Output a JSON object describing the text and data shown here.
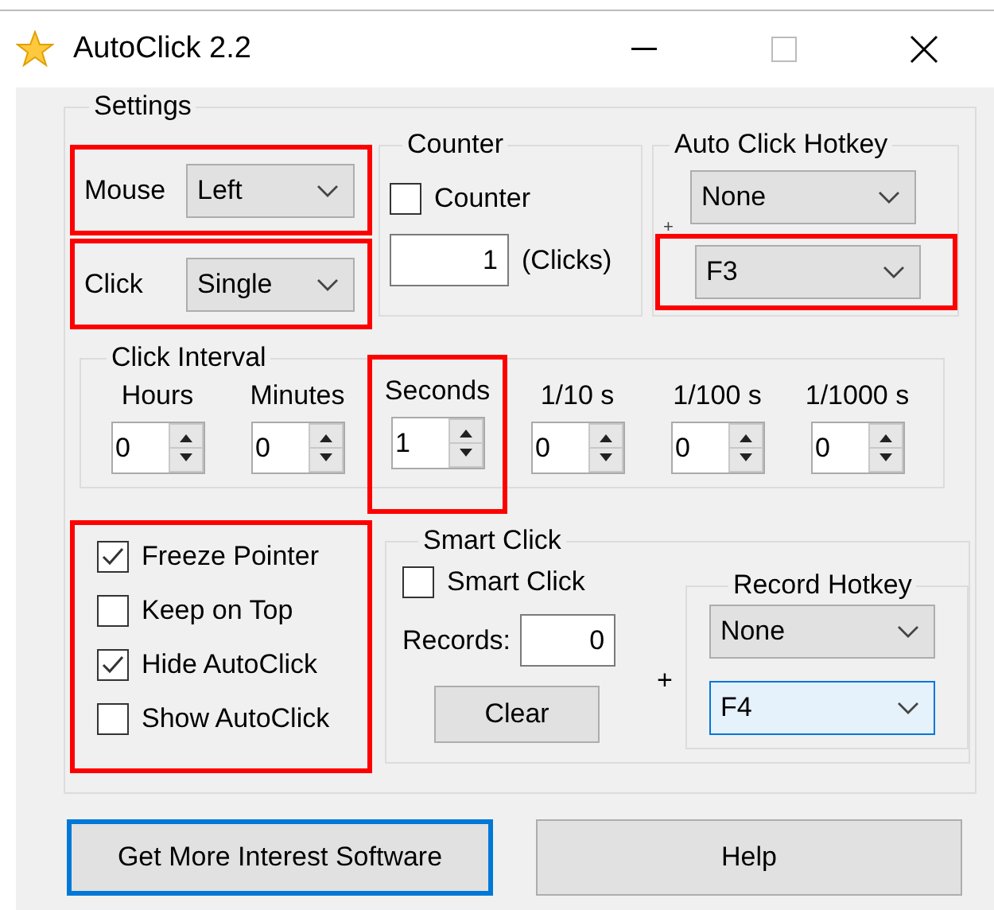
{
  "window": {
    "title": "AutoClick 2.2"
  },
  "settings": {
    "label": "Settings",
    "mouse": {
      "label": "Mouse",
      "value": "Left",
      "highlighted": true
    },
    "click": {
      "label": "Click",
      "value": "Single",
      "highlighted": true
    },
    "counter": {
      "label": "Counter",
      "checkbox_label": "Counter",
      "checked": false,
      "value": "1",
      "unit": "(Clicks)"
    },
    "auto_click_hotkey": {
      "label": "Auto Click Hotkey",
      "modifier": "None",
      "plus": "+",
      "key": "F3",
      "key_highlighted": true
    },
    "click_interval": {
      "label": "Click Interval",
      "fields": [
        {
          "label": "Hours",
          "value": "0",
          "highlighted": false
        },
        {
          "label": "Minutes",
          "value": "0",
          "highlighted": false
        },
        {
          "label": "Seconds",
          "value": "1",
          "highlighted": true
        },
        {
          "label": "1/10 s",
          "value": "0",
          "highlighted": false
        },
        {
          "label": "1/100 s",
          "value": "0",
          "highlighted": false
        },
        {
          "label": "1/1000 s",
          "value": "0",
          "highlighted": false
        }
      ]
    },
    "options": {
      "highlighted": true,
      "items": [
        {
          "label": "Freeze Pointer",
          "checked": true
        },
        {
          "label": "Keep on Top",
          "checked": false
        },
        {
          "label": "Hide AutoClick",
          "checked": true
        },
        {
          "label": "Show AutoClick",
          "checked": false
        }
      ]
    },
    "smart_click": {
      "label": "Smart Click",
      "checkbox_label": "Smart Click",
      "checked": false,
      "records_label": "Records:",
      "records": "0",
      "clear": "Clear",
      "plus": "+",
      "record_hotkey": {
        "label": "Record Hotkey",
        "modifier": "None",
        "key": "F4",
        "key_focused": true
      }
    }
  },
  "buttons": [
    {
      "label": "Get More Interest Software",
      "focused": true
    },
    {
      "label": "Help",
      "focused": false
    }
  ]
}
